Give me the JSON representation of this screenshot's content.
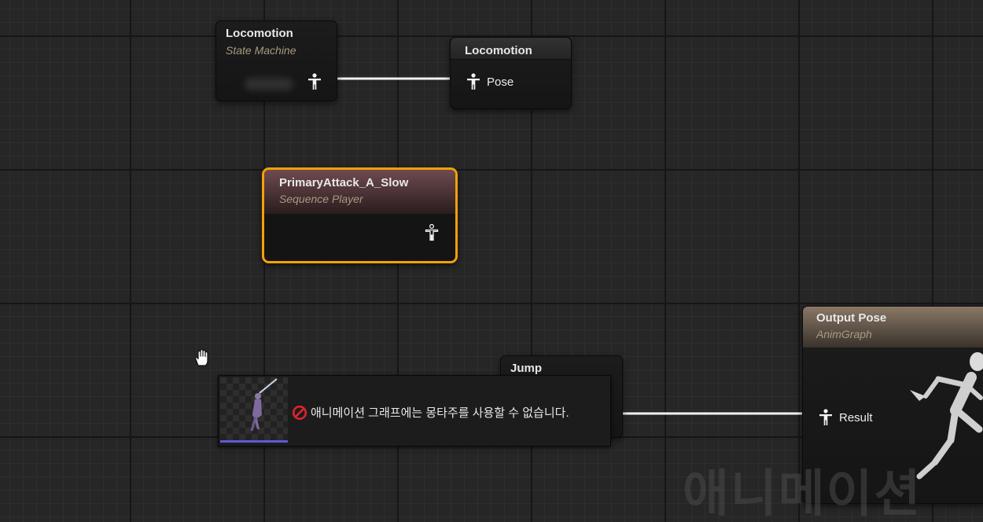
{
  "nodes": {
    "locomotion_state_machine": {
      "title": "Locomotion",
      "subtitle": "State Machine"
    },
    "locomotion_pose": {
      "title": "Locomotion",
      "pin_label": "Pose"
    },
    "primary_attack": {
      "title": "PrimaryAttack_A_Slow",
      "subtitle": "Sequence Player"
    },
    "jump": {
      "title": "Jump"
    },
    "output_pose": {
      "title": "Output Pose",
      "subtitle": "AnimGraph",
      "pin_label": "Result"
    }
  },
  "drag_tooltip": {
    "message": "애니메이션 그래프에는 몽타주를 사용할 수 없습니다.",
    "error_icon": "prohibited-icon"
  },
  "watermark": {
    "text": "애니메이션"
  },
  "icons": {
    "pose_pin": "person-icon",
    "cursor": "grab-hand-icon",
    "preview": "character-thumbnail"
  },
  "colors": {
    "selection_outline": "#f5a00a",
    "sequence_header": "#6e4b4f",
    "output_header": "#8a7866",
    "error": "#d8262b",
    "thumbnail_bar": "#5b5bd6"
  }
}
